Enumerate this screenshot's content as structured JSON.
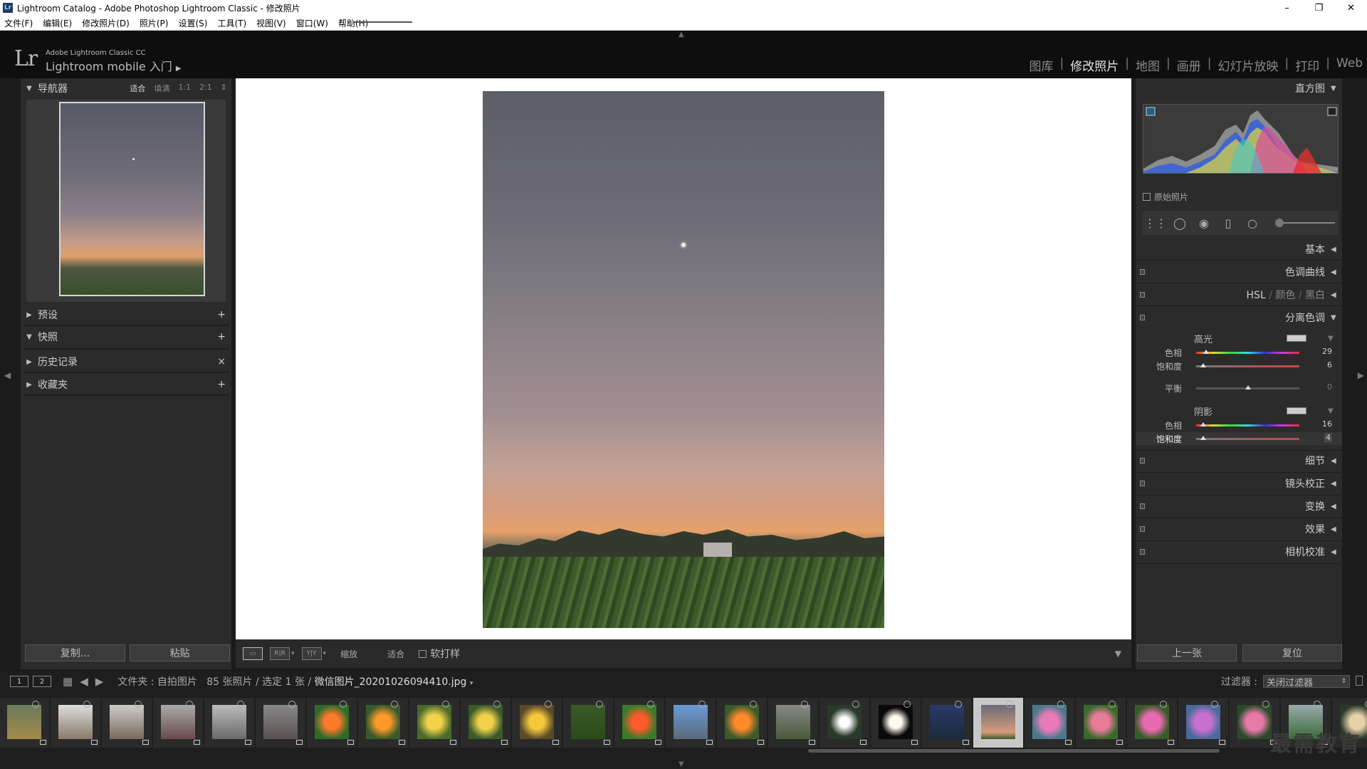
{
  "window": {
    "title": "Lightroom Catalog - Adobe Photoshop Lightroom Classic - 修改照片",
    "minimize": "–",
    "maximize": "❐",
    "close": "✕"
  },
  "menu": [
    "文件(F)",
    "编辑(E)",
    "修改照片(D)",
    "照片(P)",
    "设置(S)",
    "工具(T)",
    "视图(V)",
    "窗口(W)",
    "帮助(H)"
  ],
  "identity": {
    "logo": "Lr",
    "small": "Adobe Lightroom Classic CC",
    "big": "Lightroom mobile 入门"
  },
  "modules": [
    "图库",
    "修改照片",
    "地图",
    "画册",
    "幻灯片放映",
    "打印",
    "Web"
  ],
  "active_module": "修改照片",
  "left": {
    "navigator": {
      "label": "导航器",
      "options": [
        "适合",
        "填满",
        "1:1",
        "2:1"
      ],
      "selected": "适合"
    },
    "presets": {
      "label": "预设",
      "action": "+"
    },
    "snapshots": {
      "label": "快照",
      "action": "+"
    },
    "history": {
      "label": "历史记录",
      "action": "×"
    },
    "collections": {
      "label": "收藏夹",
      "action": "+"
    },
    "copy": "复制...",
    "paste": "粘贴"
  },
  "toolbar": {
    "zoom_label": "缩放",
    "zoom_value": "适合",
    "soft_proof": "软打样"
  },
  "right": {
    "histogram": "直方图",
    "original_photo": "原始照片",
    "panels": {
      "basic": "基本",
      "tone_curve": "色调曲线",
      "hsl": "HSL",
      "color": "颜色",
      "bw": "黑白",
      "split_toning": "分离色调",
      "detail": "细节",
      "lens": "镜头校正",
      "transform": "变换",
      "effects": "效果",
      "calibration": "相机校准"
    },
    "split": {
      "highlights": "高光",
      "shadows": "阴影",
      "hue": "色相",
      "saturation": "饱和度",
      "balance": "平衡",
      "hl_hue": "29",
      "hl_sat": "6",
      "balance_val": "0",
      "sh_hue": "16",
      "sh_sat": "4"
    },
    "prev": "上一张",
    "reset": "复位"
  },
  "filmstrip": {
    "monitor1": "1",
    "monitor2": "2",
    "folder_label": "文件夹 : 自拍图片",
    "count": "85 张照片 / 选定 1 张 /",
    "filename": "微信图片_20201026094410.jpg",
    "filter_label": "过滤器 :",
    "filter_value": "关闭过滤器"
  },
  "watermark": "最需教育",
  "colors": {
    "accent": "#e4e4e4",
    "panel": "#2b2b2b",
    "background": "#1b1b1b"
  }
}
